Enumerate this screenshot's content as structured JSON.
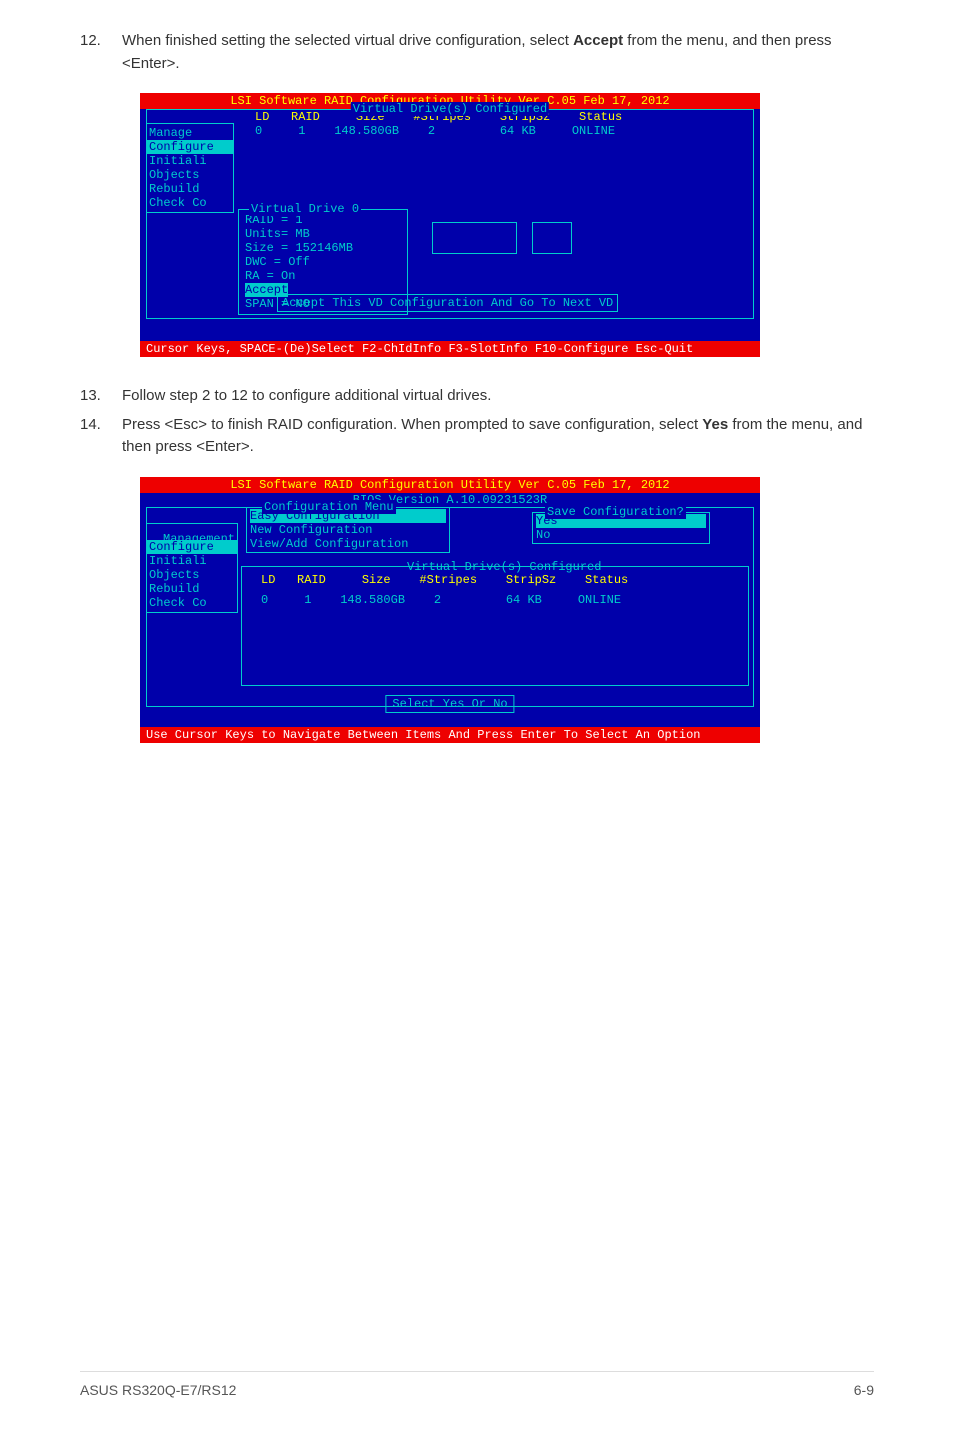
{
  "step12": {
    "num": "12.",
    "text_before": "When finished setting the selected virtual drive configuration, select ",
    "bold": "Accept",
    "text_after": " from the menu, and then press <Enter>."
  },
  "step13": {
    "num": "13.",
    "text": "Follow step 2 to 12 to configure additional virtual drives."
  },
  "step14": {
    "num": "14.",
    "text_before": "Press <Esc> to finish RAID configuration. When prompted to save configuration, select ",
    "bold": "Yes",
    "text_after": " from the menu, and then press <Enter>."
  },
  "bios1": {
    "title": "LSI Software RAID Configuration Utility Ver C.05 Feb 17, 2012",
    "vd_configured": "Virtual Drive(s) Configured",
    "header": "LD   RAID     Size    #Stripes    StripSz    Status",
    "data": "0     1    148.580GB    2         64 KB     ONLINE",
    "menu": [
      "Manage",
      "Configure",
      "Initiali",
      "Objects",
      "Rebuild",
      "Check Co"
    ],
    "vd_title": "Virtual Drive 0",
    "vd_lines": [
      "RAID = 1",
      "Units= MB",
      "Size = 152146MB",
      "DWC  = Off",
      "RA   = On",
      "Accept",
      "SPAN = NO"
    ],
    "accept_msg": "Accept This VD Configuration And Go To Next VD",
    "footer": "Cursor Keys, SPACE-(De)Select F2-ChIdInfo F3-SlotInfo F10-Configure Esc-Quit"
  },
  "bios2": {
    "title": "LSI Software RAID Configuration Utility Ver C.05 Feb 17, 2012",
    "bios_version": "BIOS Version    A.10.09231523R",
    "mgmt": "Management",
    "menu": [
      "Configure",
      "Initiali",
      "Objects",
      "Rebuild",
      "Check Co"
    ],
    "config_menu_title": "Configuration Menu",
    "config_menu": [
      "Easy Configuration",
      "New Configuration",
      "View/Add Configuration"
    ],
    "save_title": "Save Configuration?",
    "save_items": [
      "Yes",
      "No"
    ],
    "vd_configured": "Virtual Drive(s) Configured",
    "header": "LD   RAID     Size    #Stripes    StripSz    Status",
    "data": "0     1    148.580GB    2         64 KB     ONLINE",
    "select": "Select Yes Or No",
    "footer": "Use Cursor Keys to Navigate Between Items And Press Enter To Select An Option"
  },
  "footer": {
    "left": "ASUS RS320Q-E7/RS12",
    "right": "6-9"
  }
}
